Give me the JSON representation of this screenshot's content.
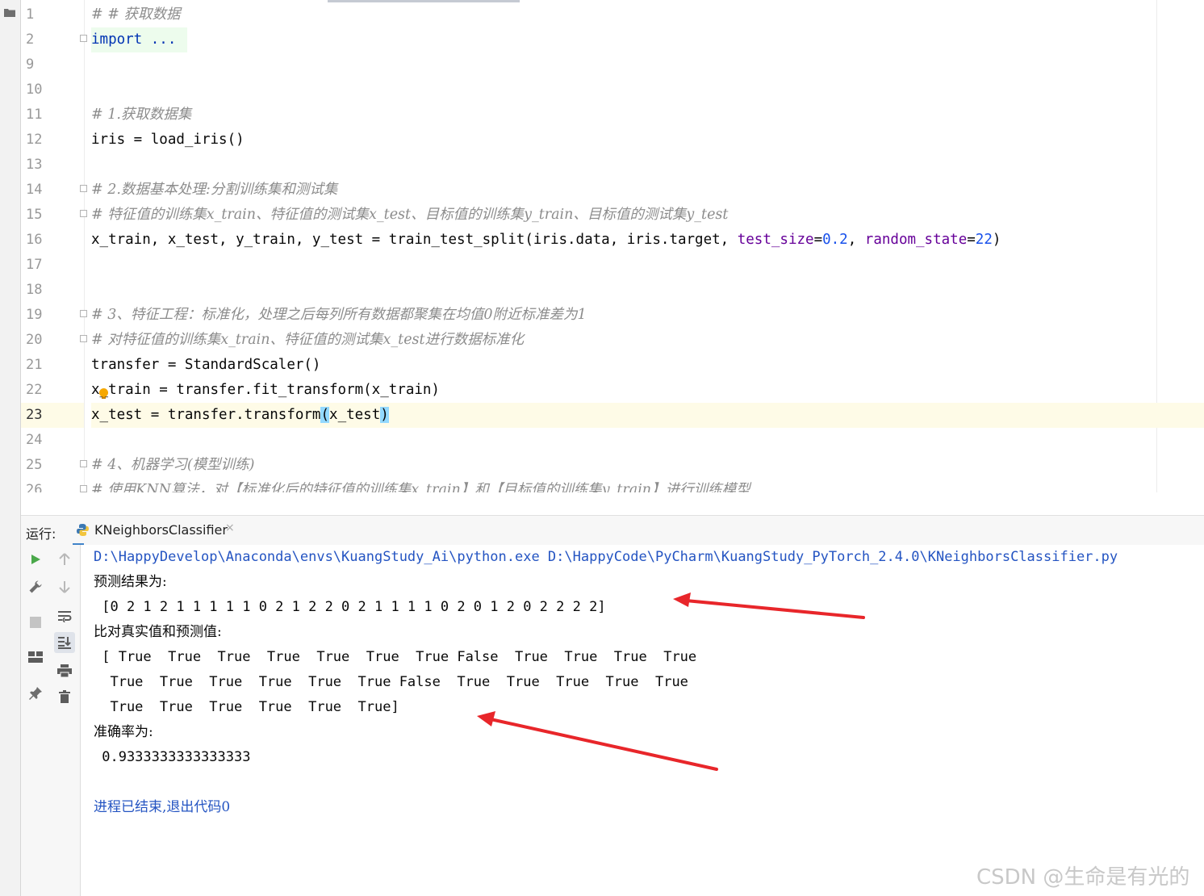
{
  "editor": {
    "line_numbers": [
      "1",
      "2",
      "9",
      "10",
      "11",
      "12",
      "13",
      "14",
      "15",
      "16",
      "17",
      "18",
      "19",
      "20",
      "21",
      "22",
      "23",
      "24",
      "25",
      "26"
    ],
    "current_line": "23",
    "lines": {
      "l1": "# # 获取数据",
      "l2": "import ...",
      "l11": "# 1.获取数据集",
      "l12": "iris = load_iris()",
      "l14": "# 2.数据基本处理:分割训练集和测试集",
      "l15": "# 特征值的训练集x_train、特征值的测试集x_test、目标值的训练集y_train、目标值的测试集y_test",
      "l16_pre": "x_train, x_test, y_train, y_test = train_test_split(iris.data, iris.target, ",
      "l16_p1": "test_size",
      "l16_eq1": "=",
      "l16_v1": "0.2",
      "l16_sep": ", ",
      "l16_p2": "random_state",
      "l16_eq2": "=",
      "l16_v2": "22",
      "l16_end": ")",
      "l19": "# 3、特征工程：标准化，处理之后每列所有数据都聚集在均值0附近标准差为1",
      "l20": "# 对特征值的训练集x_train、特征值的测试集x_test进行数据标准化",
      "l21": "transfer = StandardScaler()",
      "l22": "x_train = transfer.fit_transform(x_train)",
      "l23_pre": "x_test = transfer.transform",
      "l23_open": "(",
      "l23_arg": "x_test",
      "l23_close": ")",
      "l25": "# 4、机器学习(模型训练)",
      "l26": "# 使用KNN算法，对【标准化后的特征值的训练集x_train】和【目标值的训练集y_train】进行训练模型"
    }
  },
  "run_panel": {
    "label": "运行:",
    "tab_label": "KNeighborsClassifier",
    "close_glyph": "×"
  },
  "console": {
    "command": "D:\\HappyDevelop\\Anaconda\\envs\\KuangStudy_Ai\\python.exe D:\\HappyCode\\PyCharm\\KuangStudy_PyTorch_2.4.0\\KNeighborsClassifier.py",
    "pred_label": "预测结果为:",
    "pred_values": " [0 2 1 2 1 1 1 1 1 0 2 1 2 2 0 2 1 1 1 1 0 2 0 1 2 0 2 2 2 2]",
    "compare_label": "比对真实值和预测值:",
    "compare_line1": " [ True  True  True  True  True  True  True False  True  True  True  True",
    "compare_line2": "  True  True  True  True  True  True False  True  True  True  True  True",
    "compare_line3": "  True  True  True  True  True  True]",
    "acc_label": "准确率为:",
    "acc_value": " 0.9333333333333333",
    "exit_msg": "进程已结束,退出代码0"
  },
  "annotations": {
    "arrow_color": "#e8262a"
  },
  "watermark": "CSDN @生命是有光的"
}
